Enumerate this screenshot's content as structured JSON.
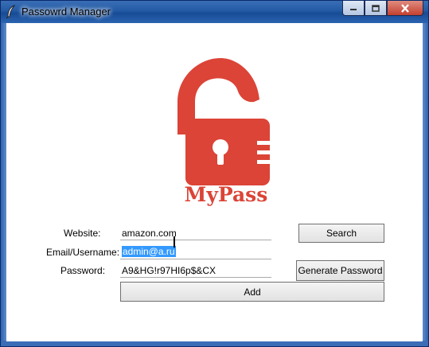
{
  "window": {
    "title": "Passowrd Manager"
  },
  "logo": {
    "text": "MyPass"
  },
  "form": {
    "website_label": "Website:",
    "website_value": "amazon.com",
    "email_label": "Email/Username:",
    "email_value": "admin@a.ru",
    "password_label": "Password:",
    "password_value": "A9&HG!r97HI6p$&CX"
  },
  "buttons": {
    "search": "Search",
    "generate": "Generate Password",
    "add": "Add"
  },
  "colors": {
    "logo_red": "#db4437",
    "titlebar": "#235aa4"
  }
}
